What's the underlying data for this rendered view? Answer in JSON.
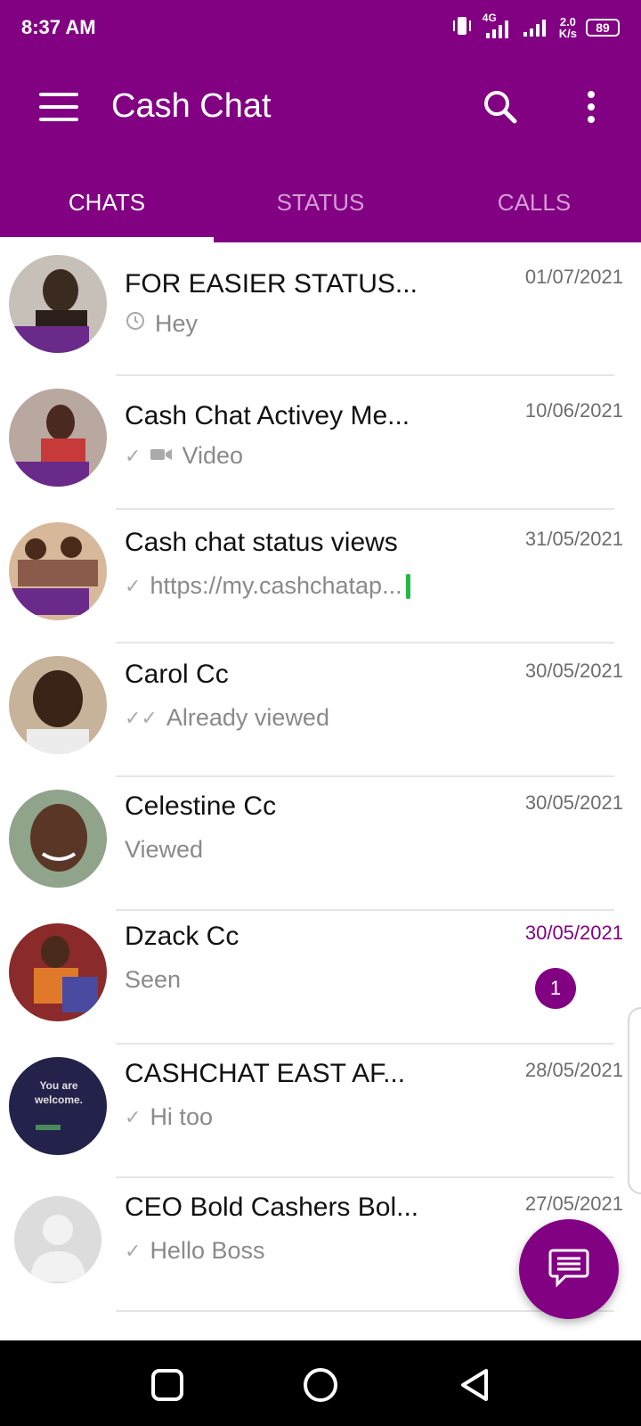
{
  "status_bar": {
    "time": "8:37 AM",
    "net_speed_value": "2.0",
    "net_speed_unit": "K/s",
    "battery": "89",
    "network": "4G"
  },
  "app": {
    "title": "Cash Chat",
    "brand_color": "#820082"
  },
  "tabs": [
    {
      "label": "CHATS",
      "active": true
    },
    {
      "label": "STATUS",
      "active": false
    },
    {
      "label": "CALLS",
      "active": false
    }
  ],
  "chats": [
    {
      "name": "FOR EASIER STATUS...",
      "date": "01/07/2021",
      "preview": "Hey",
      "status_icon": "clock-icon"
    },
    {
      "name": "Cash Chat Activey Me...",
      "date": "10/06/2021",
      "preview": "Video",
      "status_icon": "single-check-icon",
      "media_icon": "video-camera-icon"
    },
    {
      "name": "Cash chat status views",
      "date": "31/05/2021",
      "preview": "https://my.cashchatap...",
      "status_icon": "single-check-icon"
    },
    {
      "name": "Carol Cc",
      "date": "30/05/2021",
      "preview": "Already viewed",
      "status_icon": "double-check-icon"
    },
    {
      "name": "Celestine Cc",
      "date": "30/05/2021",
      "preview": "Viewed"
    },
    {
      "name": "Dzack Cc",
      "date": "30/05/2021",
      "preview": "Seen",
      "unread": "1"
    },
    {
      "name": "CASHCHAT EAST AF...",
      "date": "28/05/2021",
      "preview": "Hi too",
      "status_icon": "single-check-icon",
      "avatar_text_1": "You are",
      "avatar_text_2": "welcome."
    },
    {
      "name": "CEO Bold Cashers Bol...",
      "date": "27/05/2021",
      "preview": "Hello Boss",
      "status_icon": "single-check-icon"
    }
  ]
}
